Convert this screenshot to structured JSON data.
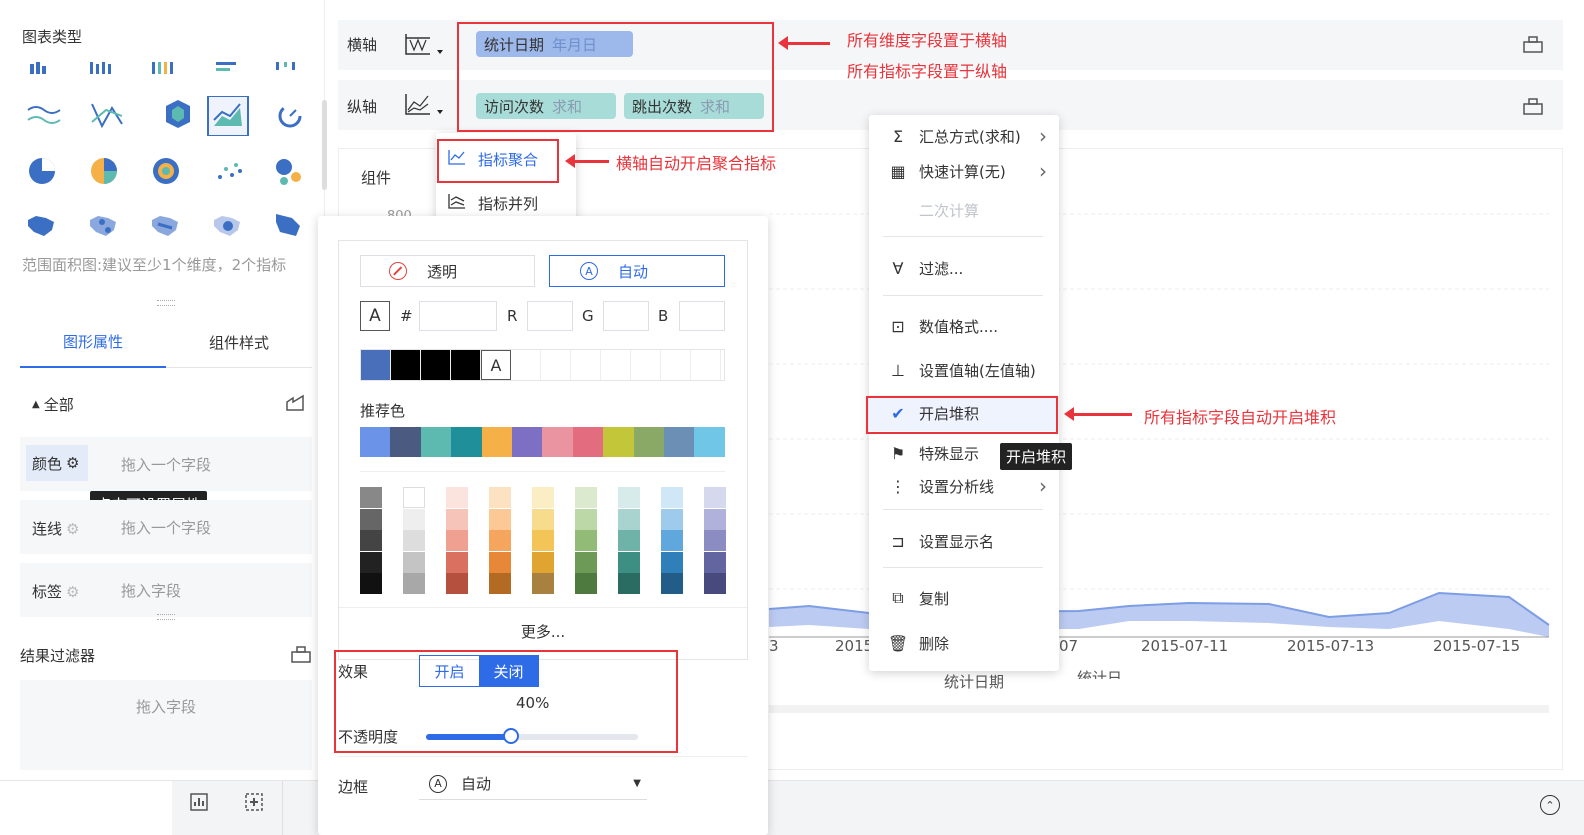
{
  "left_panel": {
    "chart_types_title": "图表类型",
    "hint": "范围面积图:建议至少1个维度，2个指标",
    "tabs": [
      "图形属性",
      "组件样式"
    ],
    "all_label": "全部",
    "rows": [
      {
        "label": "颜色",
        "placeholder": "拖入一个字段"
      },
      {
        "label": "连线",
        "placeholder": "拖入一个字段"
      },
      {
        "label": "标签",
        "placeholder": "拖入字段"
      }
    ],
    "tooltip": "点击可设置属性",
    "result_filter": "结果过滤器",
    "filter_placeholder": "拖入字段"
  },
  "axes": {
    "x_label": "横轴",
    "y_label": "纵轴",
    "x_fields": [
      {
        "name": "统计日期",
        "sub": "年月日"
      }
    ],
    "y_fields": [
      {
        "name": "访问次数",
        "sub": "求和"
      },
      {
        "name": "跳出次数",
        "sub": "求和"
      }
    ]
  },
  "component_label": "组件",
  "axis_tick_partial": "800",
  "mode_menu": [
    "指标聚合",
    "指标并列"
  ],
  "color_popup": {
    "transparent": "透明",
    "auto": "自动",
    "hash": "#",
    "r": "R",
    "g": "G",
    "b": "B",
    "recommended": "推荐色",
    "recent_colors": [
      "#4a6fba",
      "#000000",
      "#000000",
      "#000000"
    ],
    "recommended_colors": [
      "#6b93e8",
      "#4a5a80",
      "#5cbab0",
      "#1f8f99",
      "#f5b048",
      "#7d6fc4",
      "#e994a0",
      "#e36d7f",
      "#c4c63a",
      "#8aa866",
      "#6b8fb5",
      "#6fc6e6"
    ],
    "palette": [
      [
        "#888888",
        "#666666",
        "#444444",
        "#222222",
        "#111111"
      ],
      [
        "#ffffff",
        "#eeeeee",
        "#dddddd",
        "#c4c4c4",
        "#a8a8a8"
      ],
      [
        "#fbe3de",
        "#f7c4ba",
        "#efa090",
        "#d97060",
        "#b5503e"
      ],
      [
        "#fde2c2",
        "#fbc896",
        "#f5a55e",
        "#e68838",
        "#b36a22"
      ],
      [
        "#fbeec4",
        "#f8dc8e",
        "#f3c558",
        "#e0a530",
        "#a88040"
      ],
      [
        "#dbeace",
        "#bcd8a6",
        "#93bb78",
        "#6e9a58",
        "#4e7a40"
      ],
      [
        "#d6ebea",
        "#a8d3ce",
        "#6fb3a8",
        "#3d8f84",
        "#2a6c62"
      ],
      [
        "#cfe7f7",
        "#9ecbec",
        "#5fa7dc",
        "#2f7fb8",
        "#225d8a"
      ],
      [
        "#d6d8ee",
        "#b0b2dc",
        "#8b8dc2",
        "#62659f",
        "#484a7e"
      ]
    ],
    "more": "更多...",
    "effect_label": "效果",
    "effect_on": "开启",
    "effect_off": "关闭",
    "opacity_value": "40%",
    "opacity_label": "不透明度",
    "opacity_fraction": 0.4,
    "border_label": "边框",
    "border_value": "自动"
  },
  "context_menu": [
    {
      "icon": "Σ",
      "label": "汇总方式(求和)",
      "chev": true
    },
    {
      "icon": "▦",
      "label": "快速计算(无)",
      "chev": true
    },
    {
      "icon": "",
      "label": "二次计算",
      "disabled": true
    },
    {
      "icon": "∀",
      "label": "过滤..."
    },
    {
      "icon": "⊡",
      "label": "数值格式...."
    },
    {
      "icon": "⊥",
      "label": "设置值轴(左值轴)"
    },
    {
      "icon": "✔",
      "label": "开启堆积",
      "active": true
    },
    {
      "icon": "⚑",
      "label": "特殊显示"
    },
    {
      "icon": "⋮",
      "label": "设置分析线",
      "chev": true
    },
    {
      "icon": "⊐",
      "label": "设置显示名"
    },
    {
      "icon": "⧉",
      "label": "复制"
    },
    {
      "icon": "🗑",
      "label": "删除"
    }
  ],
  "context_tooltip": "开启堆积",
  "chart_axis": {
    "ticks": [
      "3",
      "2015",
      "07",
      "2015-07-11",
      "2015-07-13",
      "2015-07-15"
    ],
    "title": "统计日期",
    "title2": "统计日"
  },
  "annotations": {
    "a1": "所有维度字段置于横轴",
    "a2": "所有指标字段置于纵轴",
    "a3": "横轴自动开启聚合指标",
    "a4": "所有指标字段自动开启堆积"
  },
  "colors": {
    "accent": "#2e6be6",
    "red": "#e8343a",
    "teal_tag": "#a8dcd8",
    "blue_tag": "#9db8ea"
  }
}
